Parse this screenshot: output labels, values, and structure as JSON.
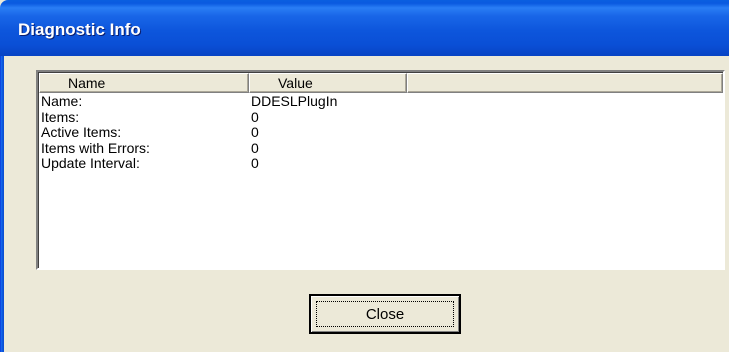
{
  "window": {
    "title": "Diagnostic Info"
  },
  "listview": {
    "columns": [
      "Name",
      "Value",
      ""
    ],
    "rows": [
      {
        "name": "Name:",
        "value": "DDESLPlugIn"
      },
      {
        "name": "Items:",
        "value": "0"
      },
      {
        "name": "Active Items:",
        "value": "0"
      },
      {
        "name": "Items with Errors:",
        "value": "0"
      },
      {
        "name": "Update Interval:",
        "value": "0"
      }
    ]
  },
  "buttons": {
    "close_label": "Close"
  },
  "colors": {
    "titlebar": "#0a4fd6",
    "dialog_background": "#ece9d8",
    "list_background": "#ffffff"
  }
}
